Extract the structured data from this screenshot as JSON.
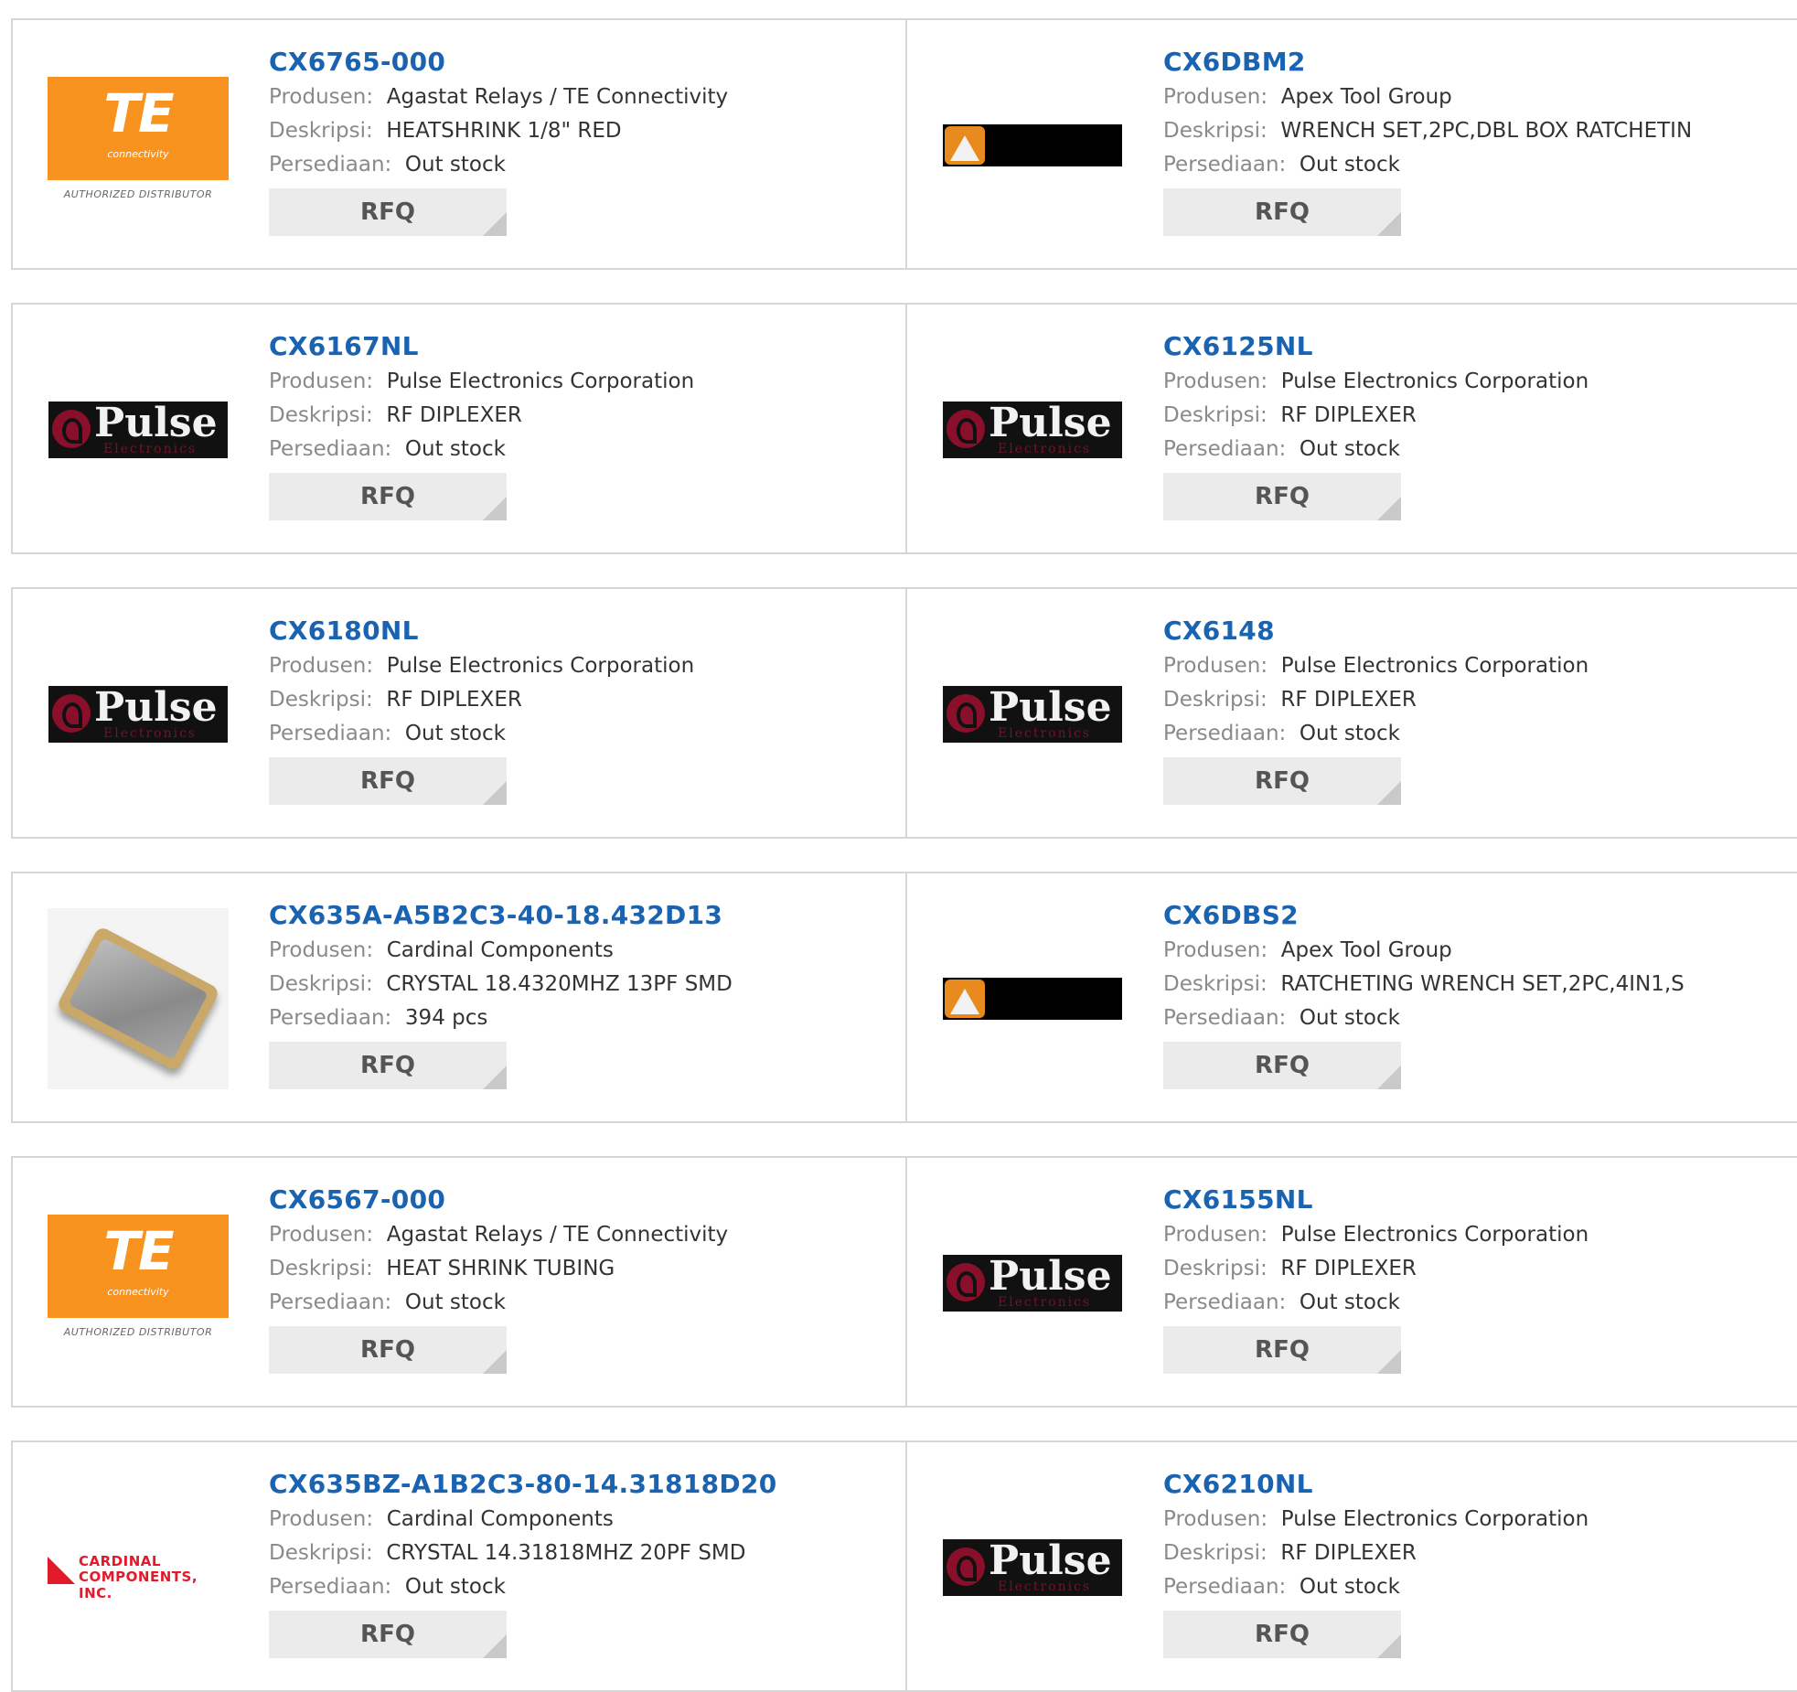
{
  "labels": {
    "manufacturer": "Produsen:",
    "description": "Deskripsi:",
    "stock": "Persediaan:",
    "rfq": "RFQ"
  },
  "logo_text": {
    "te": "TE",
    "te_sub": "connectivity",
    "te_dist": "AUTHORIZED DISTRIBUTOR",
    "pulse": "Pulse",
    "pulse_sub": "Electronics",
    "cardinal_1": "CARDINAL",
    "cardinal_2": "COMPONENTS, INC."
  },
  "products": [
    {
      "pn": "CX6765-000",
      "manufacturer": "Agastat Relays / TE Connectivity",
      "description": "HEATSHRINK 1/8\" RED",
      "stock": "Out stock",
      "logo": "te"
    },
    {
      "pn": "CX6DBM2",
      "manufacturer": "Apex Tool Group",
      "description": "WRENCH SET,2PC,DBL BOX RATCHETIN",
      "stock": "Out stock",
      "logo": "apex"
    },
    {
      "pn": "CX6167NL",
      "manufacturer": "Pulse Electronics Corporation",
      "description": "RF DIPLEXER",
      "stock": "Out stock",
      "logo": "pulse"
    },
    {
      "pn": "CX6125NL",
      "manufacturer": "Pulse Electronics Corporation",
      "description": "RF DIPLEXER",
      "stock": "Out stock",
      "logo": "pulse"
    },
    {
      "pn": "CX6180NL",
      "manufacturer": "Pulse Electronics Corporation",
      "description": "RF DIPLEXER",
      "stock": "Out stock",
      "logo": "pulse"
    },
    {
      "pn": "CX6148",
      "manufacturer": "Pulse Electronics Corporation",
      "description": "RF DIPLEXER",
      "stock": "Out stock",
      "logo": "pulse"
    },
    {
      "pn": "CX635A-A5B2C3-40-18.432D13",
      "manufacturer": "Cardinal Components",
      "description": "CRYSTAL 18.4320MHZ 13PF SMD",
      "stock": "394 pcs",
      "logo": "crystal"
    },
    {
      "pn": "CX6DBS2",
      "manufacturer": "Apex Tool Group",
      "description": "RATCHETING WRENCH SET,2PC,4IN1,S",
      "stock": "Out stock",
      "logo": "apex"
    },
    {
      "pn": "CX6567-000",
      "manufacturer": "Agastat Relays / TE Connectivity",
      "description": "HEAT SHRINK TUBING",
      "stock": "Out stock",
      "logo": "te"
    },
    {
      "pn": "CX6155NL",
      "manufacturer": "Pulse Electronics Corporation",
      "description": "RF DIPLEXER",
      "stock": "Out stock",
      "logo": "pulse"
    },
    {
      "pn": "CX635BZ-A1B2C3-80-14.31818D20",
      "manufacturer": "Cardinal Components",
      "description": "CRYSTAL 14.31818MHZ 20PF SMD",
      "stock": "Out stock",
      "logo": "cardinal"
    },
    {
      "pn": "CX6210NL",
      "manufacturer": "Pulse Electronics Corporation",
      "description": "RF DIPLEXER",
      "stock": "Out stock",
      "logo": "pulse"
    }
  ],
  "colors": {
    "link": "#1a63b0",
    "label": "#8a8a8a",
    "value": "#333333",
    "rfq_bg": "#ebebeb",
    "border": "#d6d6d6",
    "te_orange": "#f7931e",
    "pulse_red": "#8a0f2a",
    "apex_orange": "#e88a1d",
    "cardinal_red": "#e21b2a"
  }
}
